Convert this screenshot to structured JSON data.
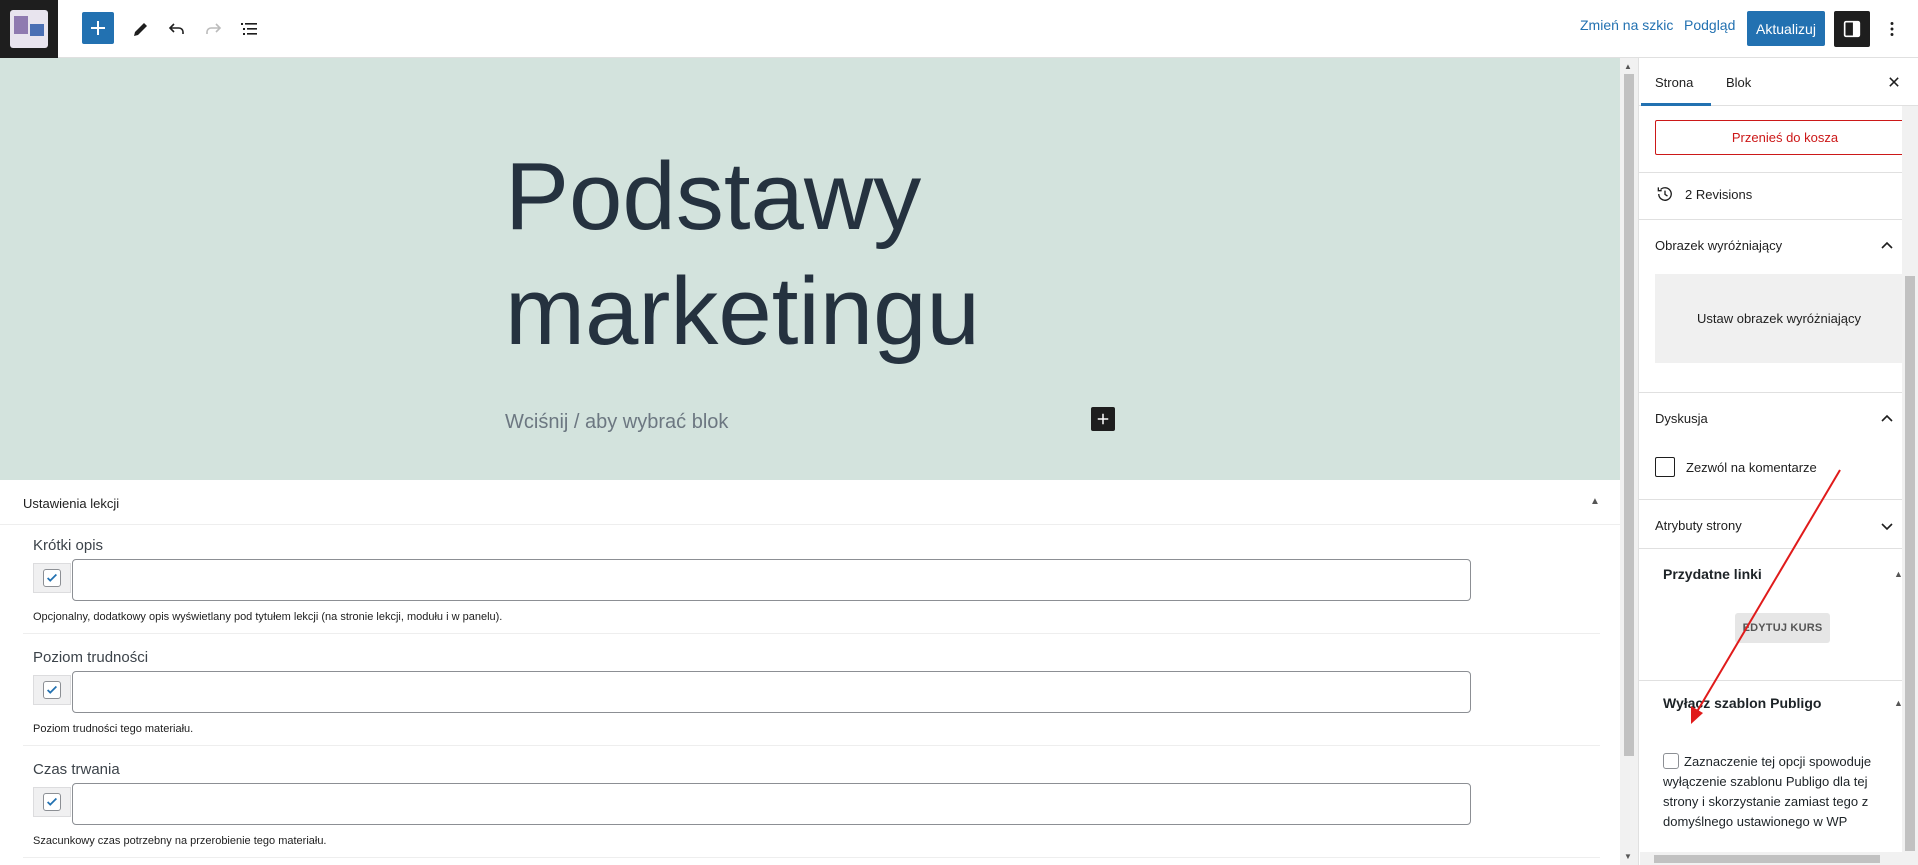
{
  "toolbar": {
    "add_block_icon": "plus-icon",
    "tools_icon": "pencil-icon",
    "undo_icon": "undo-icon",
    "redo_icon": "redo-icon",
    "outline_icon": "list-view-icon",
    "switch_to_draft": "Zmień na szkic",
    "preview": "Podgląd",
    "update": "Aktualizuj",
    "settings_icon": "sidebar-toggle-icon",
    "more_icon": "more-vertical-icon"
  },
  "editor": {
    "title_line1": "Podstawy",
    "title_line2": "marketingu",
    "block_placeholder": "Wciśnij / aby wybrać blok",
    "cover_color": "#d3e3dd"
  },
  "lesson_settings": {
    "title": "Ustawienia lekcji",
    "fields": [
      {
        "label": "Krótki opis",
        "value": "",
        "description": "Opcjonalny, dodatkowy opis wyświetlany pod tytułem lekcji (na stronie lekcji, modułu i w panelu)."
      },
      {
        "label": "Poziom trudności",
        "value": "",
        "description": "Poziom trudności tego materiału."
      },
      {
        "label": "Czas trwania",
        "value": "",
        "description": "Szacunkowy czas potrzebny na przerobienie tego materiału."
      }
    ]
  },
  "sidebar": {
    "tabs": [
      "Strona",
      "Blok"
    ],
    "active_tab": "Strona",
    "trash": "Przenieś do kosza",
    "revisions": "2 Revisions",
    "featured_image": {
      "title": "Obrazek wyróżniający",
      "button": "Ustaw obrazek wyróżniający"
    },
    "discussion": {
      "title": "Dyskusja",
      "allow_comments": "Zezwól na komentarze"
    },
    "page_attributes": {
      "title": "Atrybuty strony"
    },
    "useful_links": {
      "title": "Przydatne linki",
      "button": "EDYTUJ KURS"
    },
    "disable_template": {
      "title": "Wyłącz szablon Publigo",
      "option": "Zaznaczenie tej opcji spowoduje wyłączenie szablonu Publigo dla tej strony i skorzystanie zamiast tego z domyślnego ustawionego w WP"
    }
  },
  "colors": {
    "accent": "#2271b1",
    "danger": "#cc1818",
    "annotation_arrow": "#e01b1b"
  }
}
